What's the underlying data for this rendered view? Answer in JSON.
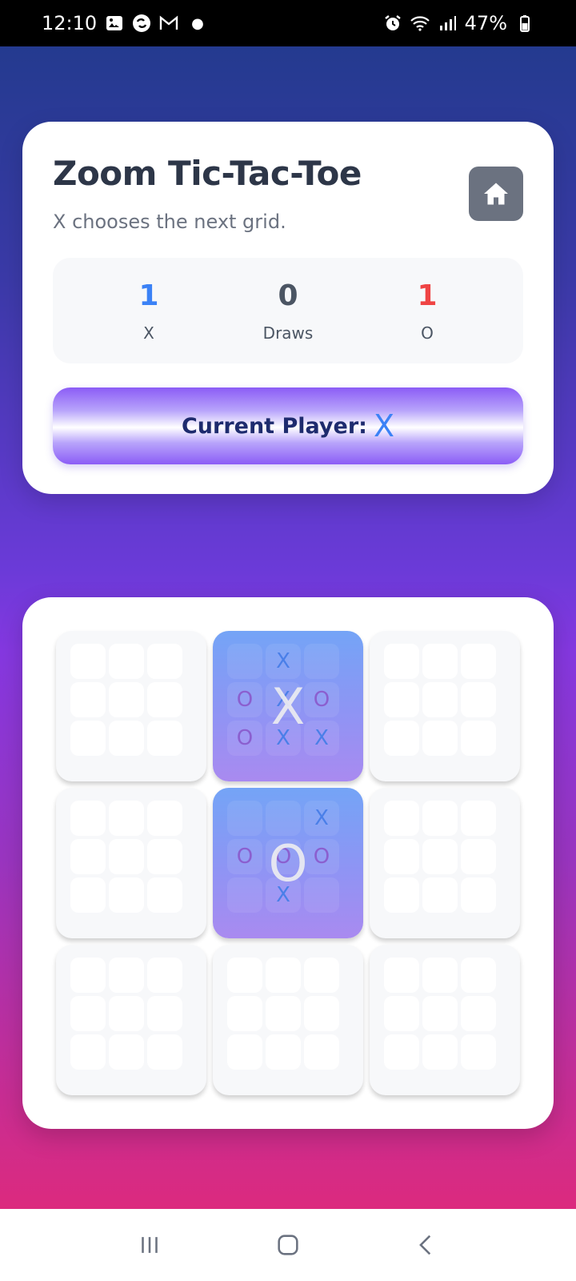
{
  "status_bar": {
    "time": "12:10",
    "battery": "47%",
    "icons_left": [
      "image-icon",
      "sync-icon",
      "gmail-icon"
    ],
    "icons_right": [
      "alarm-icon",
      "wifi-icon",
      "signal-icon",
      "battery-icon"
    ]
  },
  "header": {
    "title": "Zoom Tic-Tac-Toe",
    "subtitle": "X chooses the next grid.",
    "home_icon": "home-icon"
  },
  "scores": {
    "x": {
      "value": "1",
      "label": "X"
    },
    "draws": {
      "value": "0",
      "label": "Draws"
    },
    "o": {
      "value": "1",
      "label": "O"
    }
  },
  "turn": {
    "label": "Current Player:",
    "player": "X"
  },
  "board": {
    "sub_boards": [
      {
        "cells": [
          "",
          "",
          "",
          "",
          "",
          "",
          "",
          "",
          ""
        ],
        "winner": "",
        "active": false
      },
      {
        "cells": [
          "",
          "X",
          "",
          "O",
          "X",
          "O",
          "O",
          "X",
          "X"
        ],
        "winner": "X",
        "active": true
      },
      {
        "cells": [
          "",
          "",
          "",
          "",
          "",
          "",
          "",
          "",
          ""
        ],
        "winner": "",
        "active": false
      },
      {
        "cells": [
          "",
          "",
          "",
          "",
          "",
          "",
          "",
          "",
          ""
        ],
        "winner": "",
        "active": false
      },
      {
        "cells": [
          "",
          "",
          "X",
          "O",
          "O",
          "O",
          "",
          "X",
          ""
        ],
        "winner": "O",
        "active": true
      },
      {
        "cells": [
          "",
          "",
          "",
          "",
          "",
          "",
          "",
          "",
          ""
        ],
        "winner": "",
        "active": false
      },
      {
        "cells": [
          "",
          "",
          "",
          "",
          "",
          "",
          "",
          "",
          ""
        ],
        "winner": "",
        "active": false
      },
      {
        "cells": [
          "",
          "",
          "",
          "",
          "",
          "",
          "",
          "",
          ""
        ],
        "winner": "",
        "active": false
      },
      {
        "cells": [
          "",
          "",
          "",
          "",
          "",
          "",
          "",
          "",
          ""
        ],
        "winner": "",
        "active": false
      }
    ]
  },
  "nav": {
    "recents": "recents-icon",
    "home": "home-circle-icon",
    "back": "back-icon"
  },
  "colors": {
    "x": "#3b82f6",
    "o": "#ef4444",
    "draws": "#4b5563"
  }
}
